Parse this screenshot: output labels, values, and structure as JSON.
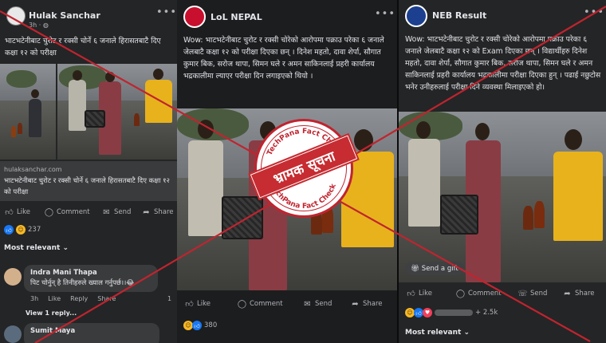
{
  "colors": {
    "cross_red": "#c0242f",
    "panel_bg": "#242526",
    "accent_blue": "#1877f2"
  },
  "post1": {
    "page_name": "Hulak Sanchar",
    "time": "3h",
    "privacy_icon": "globe-icon",
    "text": "भाटभटेनीबाट चुरोट र रक्सी चोर्ने ६ जनाले हिरासतबाटै दिए कक्षा १२ को परीक्षा",
    "link_domain": "hulaksanchar.com",
    "link_title": "भाटभटेनीबाट चुरोट र रक्सी चोर्ने ६ जनाले हिरासतबाटै दिए कक्षा १२ को परीक्षा",
    "actions": {
      "like": "Like",
      "comment": "Comment",
      "send": "Send",
      "share": "Share"
    },
    "reaction_count": "237",
    "most_relevant": "Most relevant",
    "comment1": {
      "name": "Indra Mani Thapa",
      "text": "पिट चोर्नुन् है तिनीहरुले ख्याल गर्नुपर्छ।।😂",
      "time": "3h",
      "like": "Like",
      "reply": "Reply",
      "share": "Share",
      "count": "1"
    },
    "view_replies": "View 1 reply...",
    "comment2": {
      "name": "Sumit Maya"
    }
  },
  "post2": {
    "page_name": "LoL NEPAL",
    "text": "Wow: भाटभटेनीबाट चुरोट र रक्सी चोरेको आरोपमा पक्राउ परेका ६ जनाले जेलबाटै कक्षा १२ को परीक्षा दिएका छन् । दिनेश महतो, दावा शेर्पा, सौगात कुमार बिक, सरोज थापा, सिमन घले र अमन साकिनलाई प्रहरी कार्यालय भद्रकालीमा ल्याएर परीक्षा दिन लगाइएको थियो ।",
    "actions": {
      "like": "Like",
      "comment": "Comment",
      "send": "Send",
      "share": "Share"
    },
    "reaction_count": "380"
  },
  "post3": {
    "page_name": "NEB Result",
    "text": "Wow: भाटभटेनीबाट चुरोट र रक्सी चोरेको आरोपमा पक्राउ परेका ६ जनाले जेलबाटै कक्षा १२ को Exam दिएका छन् । विद्यार्थीहरु दिनेश महतो, दावा शेर्पा, सौगात कुमार बिक, सरोज थापा, सिमन घले र अमन साकिनलाई प्रहरी कार्यालय भद्रकालीमा परीक्षा दिएका हुन् । पढाई नछुटोस भनेर उनीहरुलाई परीक्षा दिने व्यवस्था मिलाइएको हो।",
    "gift": "Send a gift",
    "actions": {
      "like": "Like",
      "comment": "Comment",
      "whatsapp": "Send",
      "share": "Share"
    },
    "reaction_count": "+ 2.5k",
    "most_relevant": "Most relevant"
  },
  "stamp": {
    "label": "भ्रामक सूचना",
    "arc_top": "TechPana Fact Check",
    "arc_bottom": "TechPana Fact Check"
  }
}
